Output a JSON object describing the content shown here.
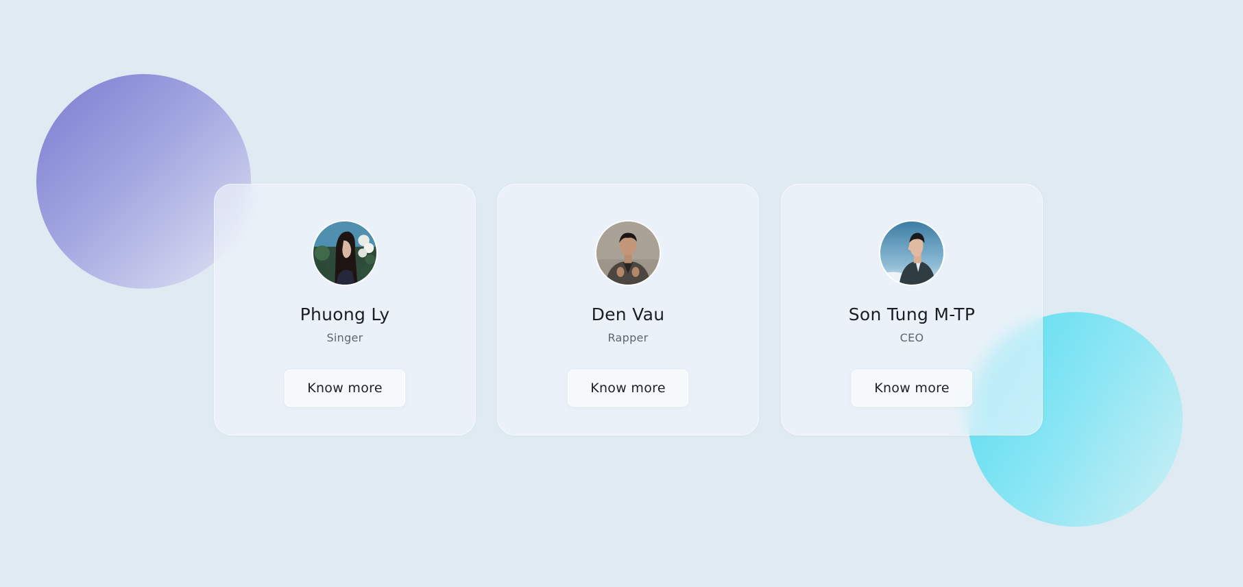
{
  "colors": {
    "background": "#e0eaf2",
    "blob_purple": "#7a7cd0",
    "blob_cyan": "#55dcf0",
    "name_text": "#1b1d24",
    "role_text": "#5c6470"
  },
  "profiles": [
    {
      "name": "Phuong Ly",
      "role": "Singer",
      "button_label": "Know more",
      "avatar_icon": "avatar-photo-woman-flowers"
    },
    {
      "name": "Den Vau",
      "role": "Rapper",
      "button_label": "Know more",
      "avatar_icon": "avatar-photo-man-suit"
    },
    {
      "name": "Son Tung M-TP",
      "role": "CEO",
      "button_label": "Know more",
      "avatar_icon": "avatar-photo-man-profile-sky"
    }
  ]
}
